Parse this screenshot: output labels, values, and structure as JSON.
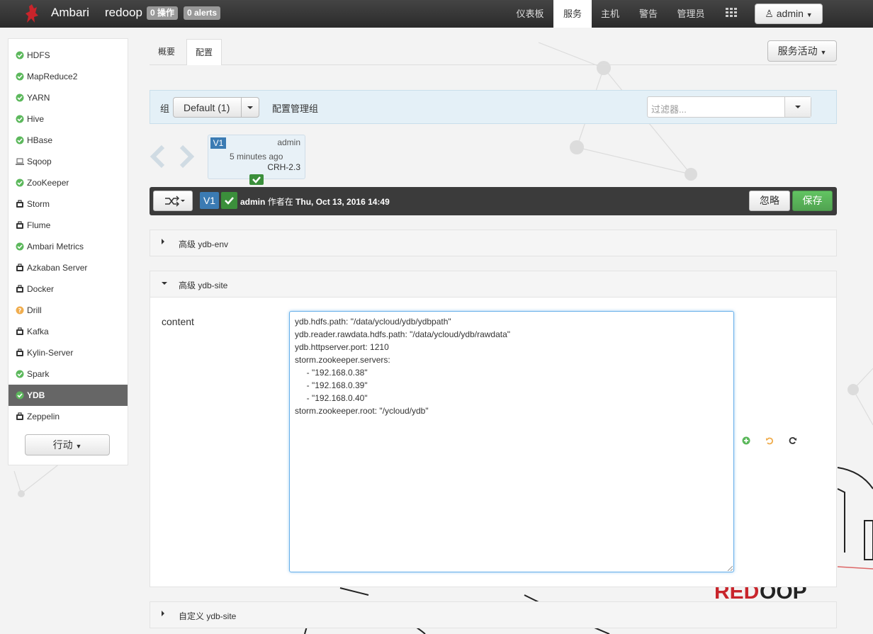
{
  "navbar": {
    "brand": "Ambari",
    "cluster": "redoop",
    "ops_badge": "0 操作",
    "alerts_badge": "0 alerts",
    "nav": [
      {
        "label": "仪表板"
      },
      {
        "label": "服务"
      },
      {
        "label": "主机"
      },
      {
        "label": "警告"
      },
      {
        "label": "管理员"
      }
    ],
    "user": "admin"
  },
  "sidebar": {
    "services": [
      {
        "label": "HDFS",
        "status": "ok"
      },
      {
        "label": "MapReduce2",
        "status": "ok"
      },
      {
        "label": "YARN",
        "status": "ok"
      },
      {
        "label": "Hive",
        "status": "ok"
      },
      {
        "label": "HBase",
        "status": "ok"
      },
      {
        "label": "Sqoop",
        "status": "client"
      },
      {
        "label": "ZooKeeper",
        "status": "ok"
      },
      {
        "label": "Storm",
        "status": "maintenance"
      },
      {
        "label": "Flume",
        "status": "maintenance"
      },
      {
        "label": "Ambari Metrics",
        "status": "ok"
      },
      {
        "label": "Azkaban Server",
        "status": "maintenance"
      },
      {
        "label": "Docker",
        "status": "maintenance"
      },
      {
        "label": "Drill",
        "status": "unknown"
      },
      {
        "label": "Kafka",
        "status": "maintenance"
      },
      {
        "label": "Kylin-Server",
        "status": "maintenance"
      },
      {
        "label": "Spark",
        "status": "ok"
      },
      {
        "label": "YDB",
        "status": "ok",
        "active": true
      },
      {
        "label": "Zeppelin",
        "status": "maintenance"
      }
    ],
    "action_button": "行动"
  },
  "tabs": [
    {
      "label": "概要"
    },
    {
      "label": "配置"
    }
  ],
  "service_actions": "服务活动",
  "config_group": {
    "label": "组",
    "selected": "Default (1)",
    "manage_link": "配置管理组",
    "filter_placeholder": "过滤器..."
  },
  "version_card": {
    "version": "V1",
    "author": "admin",
    "time": "5 minutes ago",
    "stack": "CRH-2.3"
  },
  "current_bar": {
    "version": "V1",
    "author": "admin",
    "authored_text": "作者在",
    "timestamp": "Thu, Oct 13, 2016 14:49",
    "discard": "忽略",
    "save": "保存"
  },
  "sections": [
    {
      "title": "高级 ydb-env",
      "expanded": false
    },
    {
      "title": "高级 ydb-site",
      "expanded": true
    },
    {
      "title": "自定义 ydb-site",
      "expanded": false
    }
  ],
  "property": {
    "name": "content",
    "lines": [
      "ydb.hdfs.path: \"/data/ycloud/ydb/ydbpath\"",
      "ydb.reader.rawdata.hdfs.path: \"/data/ycloud/ydb/rawdata\"",
      "ydb.httpserver.port: 1210",
      "storm.zookeeper.servers:",
      "     - \"192.168.0.38\"",
      "     - \"192.168.0.39\"",
      "     - \"192.168.0.40\"",
      "storm.zookeeper.root: \"/ycloud/ydb\""
    ]
  },
  "colors": {
    "ok": "#5cb85c",
    "unknown": "#f0ad4e",
    "primary": "#3b7bb3",
    "save": "#5cb85c"
  }
}
